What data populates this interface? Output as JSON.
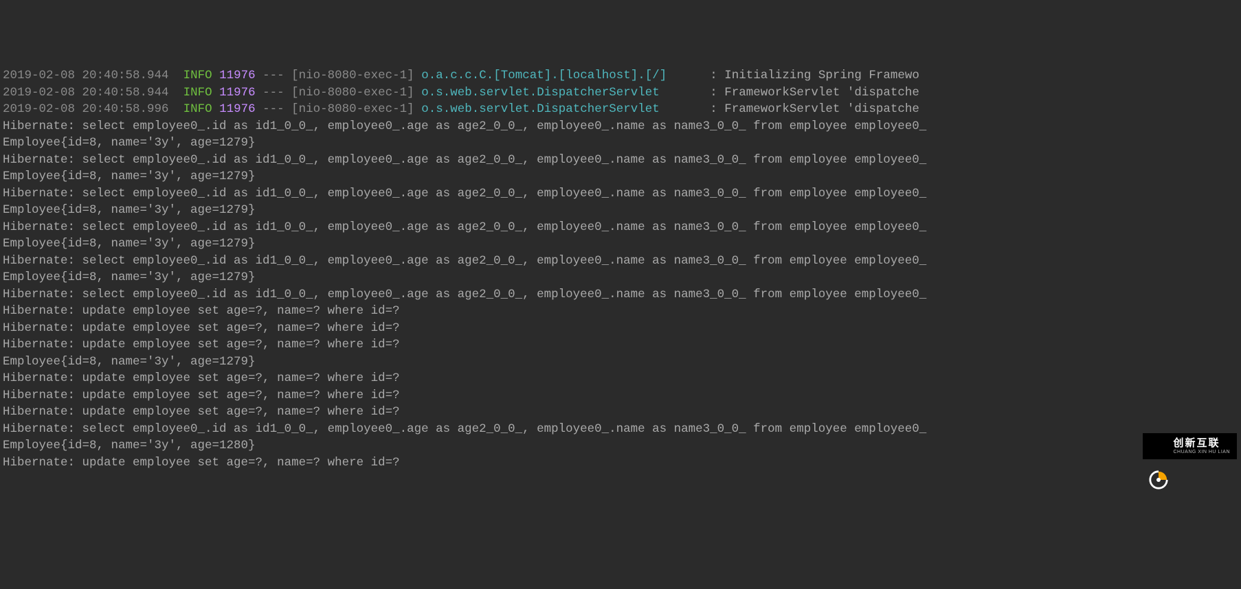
{
  "log_prefix_lines": [
    {
      "ts": "2019-02-08 20:40:58.944",
      "level": "INFO",
      "pid": "11976",
      "sep": "---",
      "thread": "[nio-8080-exec-1]",
      "logger": "o.a.c.c.C.[Tomcat].[localhost].[/]     ",
      "msg": ": Initializing Spring Framewo"
    },
    {
      "ts": "2019-02-08 20:40:58.944",
      "level": "INFO",
      "pid": "11976",
      "sep": "---",
      "thread": "[nio-8080-exec-1]",
      "logger": "o.s.web.servlet.DispatcherServlet      ",
      "msg": ": FrameworkServlet 'dispatche"
    },
    {
      "ts": "2019-02-08 20:40:58.996",
      "level": "INFO",
      "pid": "11976",
      "sep": "---",
      "thread": "[nio-8080-exec-1]",
      "logger": "o.s.web.servlet.DispatcherServlet      ",
      "msg": ": FrameworkServlet 'dispatche"
    }
  ],
  "plain_lines": [
    "Hibernate: select employee0_.id as id1_0_0_, employee0_.age as age2_0_0_, employee0_.name as name3_0_0_ from employee employee0_",
    "Employee{id=8, name='3y', age=1279}",
    "Hibernate: select employee0_.id as id1_0_0_, employee0_.age as age2_0_0_, employee0_.name as name3_0_0_ from employee employee0_",
    "Employee{id=8, name='3y', age=1279}",
    "Hibernate: select employee0_.id as id1_0_0_, employee0_.age as age2_0_0_, employee0_.name as name3_0_0_ from employee employee0_",
    "Employee{id=8, name='3y', age=1279}",
    "Hibernate: select employee0_.id as id1_0_0_, employee0_.age as age2_0_0_, employee0_.name as name3_0_0_ from employee employee0_",
    "Employee{id=8, name='3y', age=1279}",
    "Hibernate: select employee0_.id as id1_0_0_, employee0_.age as age2_0_0_, employee0_.name as name3_0_0_ from employee employee0_",
    "Employee{id=8, name='3y', age=1279}",
    "Hibernate: select employee0_.id as id1_0_0_, employee0_.age as age2_0_0_, employee0_.name as name3_0_0_ from employee employee0_",
    "Hibernate: update employee set age=?, name=? where id=?",
    "Hibernate: update employee set age=?, name=? where id=?",
    "Hibernate: update employee set age=?, name=? where id=?",
    "Employee{id=8, name='3y', age=1279}",
    "Hibernate: update employee set age=?, name=? where id=?",
    "Hibernate: update employee set age=?, name=? where id=?",
    "Hibernate: update employee set age=?, name=? where id=?",
    "Hibernate: select employee0_.id as id1_0_0_, employee0_.age as age2_0_0_, employee0_.name as name3_0_0_ from employee employee0_",
    "Employee{id=8, name='3y', age=1280}",
    "Hibernate: update employee set age=?, name=? where id=?"
  ],
  "watermark": {
    "text_big": "创新互联",
    "text_small": "CHUANG XIN HU LIAN",
    "accent": "#f5a300"
  }
}
